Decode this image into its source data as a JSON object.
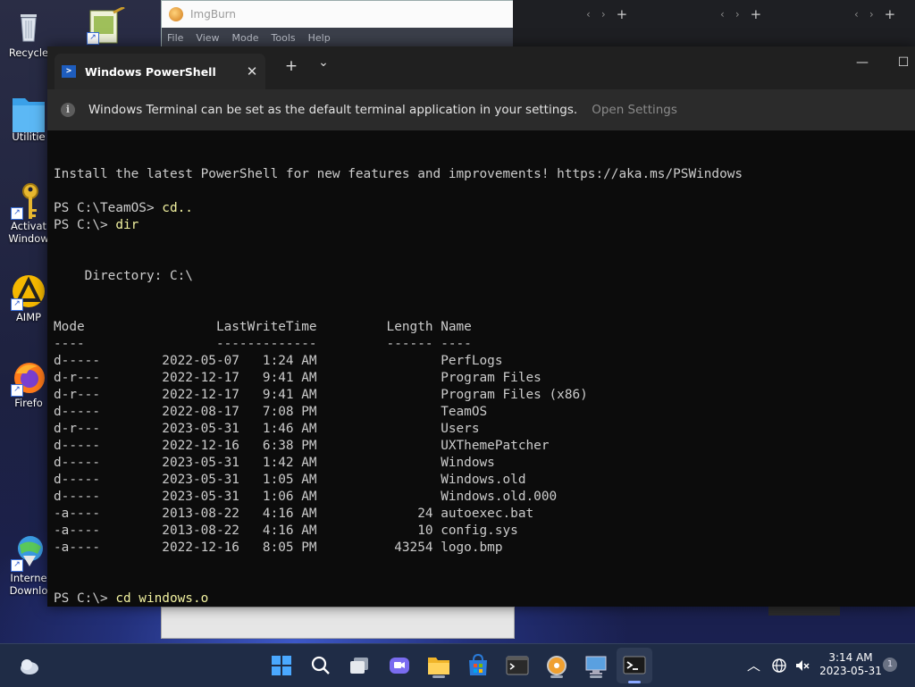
{
  "desktop": {
    "icons": [
      {
        "label": "Recycle",
        "icon": "recycle-bin-icon"
      },
      {
        "label": "Utilitie",
        "icon": "folder-icon"
      },
      {
        "label": "Activat",
        "label2": "Window",
        "icon": "key-icon"
      },
      {
        "label": "AIMP",
        "icon": "aimp-icon"
      },
      {
        "label": "Firefo",
        "icon": "firefox-icon"
      },
      {
        "label": "Interne",
        "label2": "Downlo",
        "icon": "internet-download-icon"
      }
    ]
  },
  "background_window": {
    "title": "ImgBurn",
    "menu": [
      "File",
      "View",
      "Mode",
      "Tools",
      "Help"
    ]
  },
  "terminal": {
    "tab_title": "Windows PowerShell",
    "new_tab": "+",
    "dropdown": "⌄",
    "minimize": "—",
    "maximize": "☐",
    "info_text": "Windows Terminal can be set as the default terminal application in your settings.",
    "info_link": "Open Settings",
    "lines": [
      "",
      "Install the latest PowerShell for new features and improvements! https://aka.ms/PSWindows",
      "",
      {
        "prompt": "PS C:\\TeamOS> ",
        "cmd": "cd.."
      },
      {
        "prompt": "PS C:\\> ",
        "cmd": "dir"
      },
      "",
      "",
      "    Directory: C:\\",
      "",
      "",
      "Mode                 LastWriteTime         Length Name",
      "----                 -------------         ------ ----",
      "d-----        2022-05-07   1:24 AM                PerfLogs",
      "d-r---        2022-12-17   9:41 AM                Program Files",
      "d-r---        2022-12-17   9:41 AM                Program Files (x86)",
      "d-----        2022-08-17   7:08 PM                TeamOS",
      "d-r---        2023-05-31   1:46 AM                Users",
      "d-----        2022-12-16   6:38 PM                UXThemePatcher",
      "d-----        2023-05-31   1:42 AM                Windows",
      "d-----        2023-05-31   1:05 AM                Windows.old",
      "d-----        2023-05-31   1:06 AM                Windows.old.000",
      "-a----        2013-08-22   4:16 AM             24 autoexec.bat",
      "-a----        2013-08-22   4:16 AM             10 config.sys",
      "-a----        2022-12-16   8:05 PM          43254 logo.bmp",
      "",
      "",
      {
        "prompt": "PS C:\\> ",
        "cmd": "cd windows.o"
      }
    ]
  },
  "taskbar": {
    "apps": [
      "start-icon",
      "search-icon",
      "task-view-icon",
      "chat-icon",
      "file-explorer-icon",
      "store-icon",
      "terminal-app-icon",
      "imgburn-app-icon",
      "remote-desktop-icon",
      "powershell-app-icon"
    ],
    "time": "3:14 AM",
    "date": "2023-05-31",
    "notification_count": "1"
  }
}
